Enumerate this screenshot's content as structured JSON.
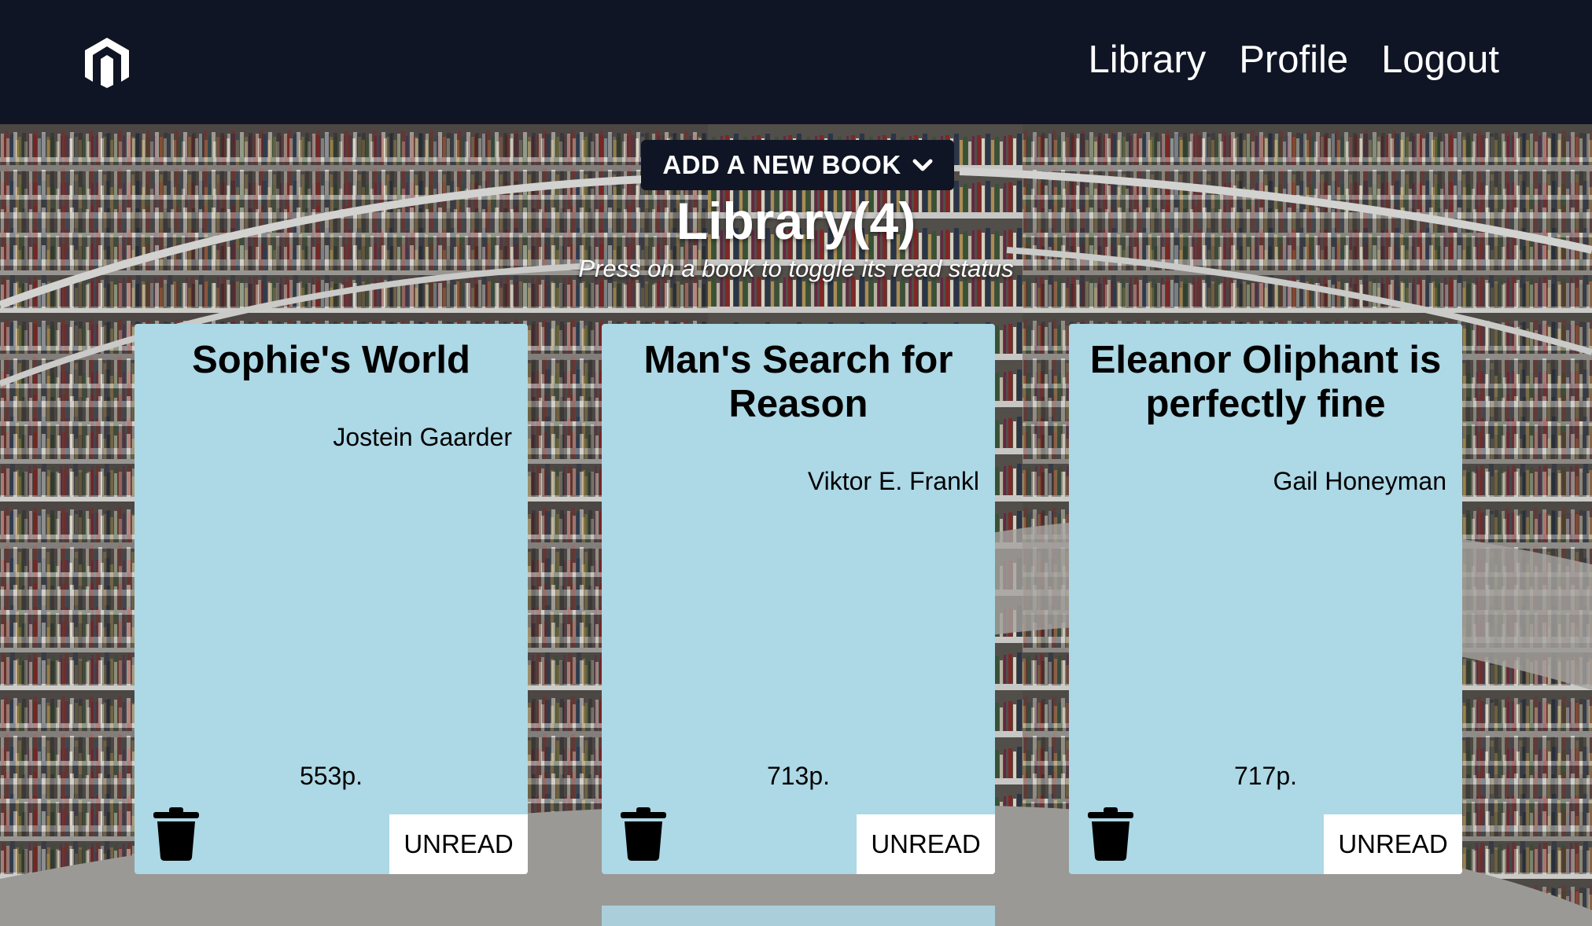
{
  "header": {
    "logo_icon": "magento-logo-icon",
    "nav": [
      {
        "label": "Library"
      },
      {
        "label": "Profile"
      },
      {
        "label": "Logout"
      }
    ]
  },
  "controls": {
    "add_book_label": "ADD A NEW BOOK",
    "add_book_icon": "chevron-down-icon"
  },
  "library": {
    "title": "Library(4)",
    "hint": "Press on a book to toggle its read status"
  },
  "books": [
    {
      "title": "Sophie's World",
      "author": "Jostein Gaarder",
      "pages": "553p.",
      "status": "UNREAD",
      "delete_icon": "trash-icon"
    },
    {
      "title": "Man's Search for Reason",
      "author": "Viktor E. Frankl",
      "pages": "713p.",
      "status": "UNREAD",
      "delete_icon": "trash-icon"
    },
    {
      "title": "Eleanor Oliphant is perfectly fine",
      "author": "Gail Honeyman",
      "pages": "717p.",
      "status": "UNREAD",
      "delete_icon": "trash-icon"
    }
  ],
  "colors": {
    "header_bg": "#0f1524",
    "card_bg": "#add8e6",
    "button_bg": "#ffffff",
    "text_light": "#ffffff"
  }
}
